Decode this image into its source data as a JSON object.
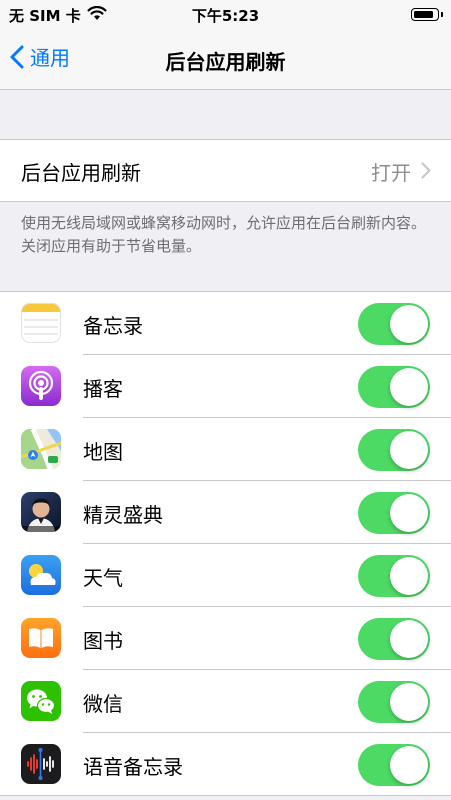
{
  "status_bar": {
    "carrier": "无 SIM 卡",
    "time": "下午5:23",
    "battery_level": 0.85
  },
  "nav": {
    "back_label": "通用",
    "title": "后台应用刷新"
  },
  "setting": {
    "label": "后台应用刷新",
    "value": "打开"
  },
  "footer": "使用无线局域网或蜂窝移动网时，允许应用在后台刷新内容。关闭应用有助于节省电量。",
  "apps": [
    {
      "name": "备忘录",
      "icon": "notes-icon",
      "enabled": true
    },
    {
      "name": "播客",
      "icon": "podcasts-icon",
      "enabled": true
    },
    {
      "name": "地图",
      "icon": "maps-icon",
      "enabled": true
    },
    {
      "name": "精灵盛典",
      "icon": "game-avatar-icon",
      "enabled": true
    },
    {
      "name": "天气",
      "icon": "weather-icon",
      "enabled": true
    },
    {
      "name": "图书",
      "icon": "books-icon",
      "enabled": true
    },
    {
      "name": "微信",
      "icon": "wechat-icon",
      "enabled": true
    },
    {
      "name": "语音备忘录",
      "icon": "voice-memos-icon",
      "enabled": true
    }
  ],
  "colors": {
    "toggle_on": "#4cd964",
    "accent": "#007aff"
  }
}
